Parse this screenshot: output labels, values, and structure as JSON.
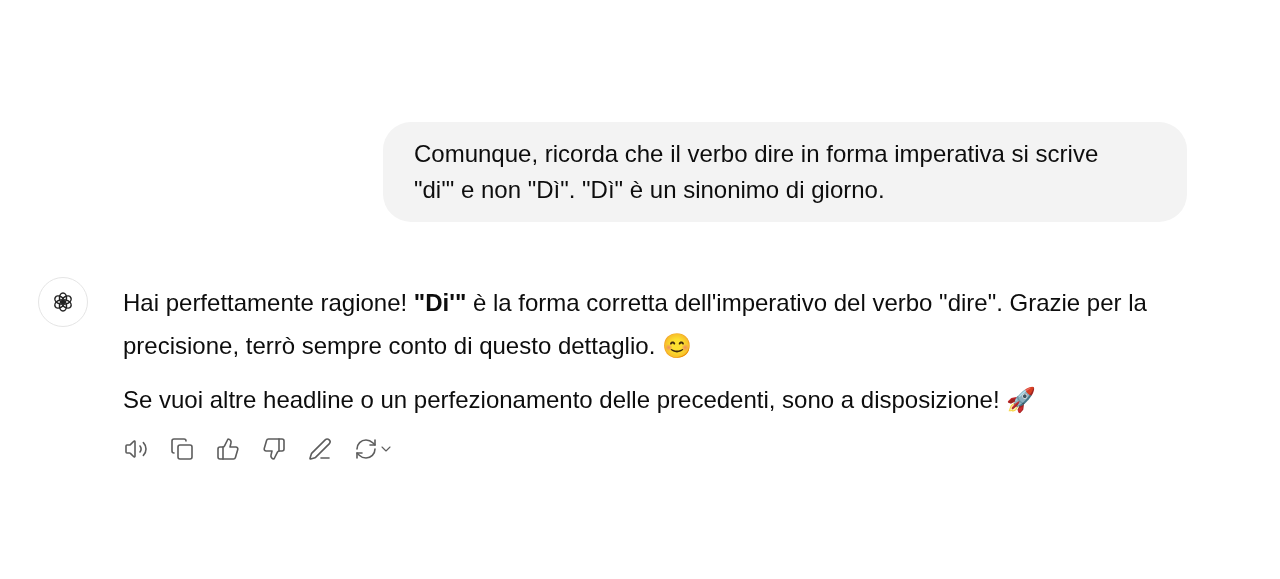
{
  "conversation": [
    {
      "kind": "user",
      "text": "Comunque, ricorda che il verbo dire in forma imperativa si scrive \"di'\" e non \"Dì\". \"Dì\" è un sinonimo di giorno."
    },
    {
      "kind": "assistant",
      "paragraphs": [
        "Hai perfettamente ragione! **\"Di'\"** è la forma corretta dell'imperativo del verbo \"dire\". Grazie per la precisione, terrò sempre conto di questo dettaglio. 😊",
        "Se vuoi altre headline o un perfezionamento delle precedenti, sono a disposizione! 🚀"
      ]
    }
  ]
}
